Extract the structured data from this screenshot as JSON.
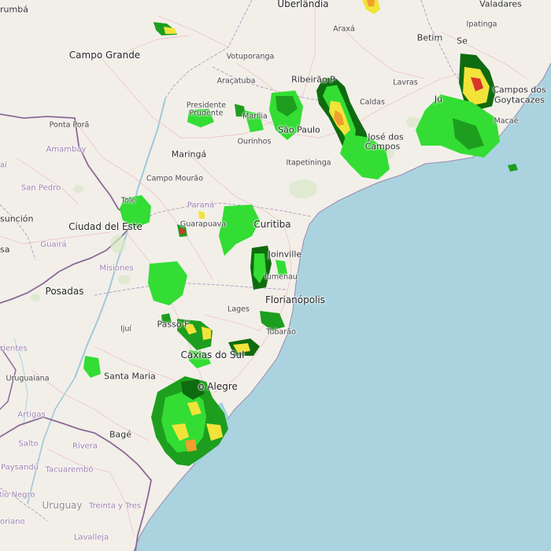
{
  "map": {
    "colors": {
      "land": "#f2efe9",
      "water": "#aad3df",
      "radar_light": "#33dd33",
      "radar_mid": "#1e9e1e",
      "radar_dark": "#0f6b0f",
      "radar_yellow": "#f2e33a",
      "radar_orange": "#f29e2e",
      "radar_red": "#d9342b",
      "border": "#8c6a97",
      "road": "#f2b7b7"
    },
    "labels": {
      "uberlandia": "Uberlândia",
      "umbara": "rumbá",
      "valadares": "Valadares",
      "araxa": "Araxá",
      "belo": "Betim",
      "se": "Se",
      "ipatinga": "Ipatinga",
      "campo_grande": "Campo Grande",
      "votuporanga": "Votuporanga",
      "aracatuba": "Araçatuba",
      "ribeirao": "Ribeirão P",
      "lavras": "Lavras",
      "campos": "Campos dos",
      "goytacazes": "Goytacazes",
      "ju": "Ju",
      "presidente": "Presidente",
      "prudente": "Prudente",
      "marilia": "Marília",
      "caldas": "Caldas",
      "ponta_pora": "Ponta Porã",
      "sao_paulo": "São Paulo",
      "jose_dos": "José dos",
      "campos2": "Campos",
      "macae": "Macaé",
      "amambay": "Amambay",
      "ourinhos": "Ourinhos",
      "maringa": "Maringá",
      "ai": "ai",
      "itapetininga": "Itapetininga",
      "san_pedro": "San Pedro",
      "campo_mourao": "Campo Mourão",
      "toledo": "Tole",
      "parana": "Paraná",
      "asuncion": "sunción",
      "ciudad_del_este": "Ciudad del Este",
      "guarapuava": "Guarapuava",
      "curitiba": "Curitiba",
      "guaira": "Guairá",
      "sa": "sa",
      "joinville": "Joinville",
      "misiones": "Misiones",
      "blumenau": "lumenau",
      "posadas": "Posadas",
      "florianopolis": "Florianópolis",
      "lages": "Lages",
      "passo_fundo": "Passo F",
      "ijui": "Ijuí",
      "tubarao": "Tubarão",
      "rientes": "rientes",
      "caxias": "Caxias do Sul",
      "santa_maria": "Santa Maria",
      "uruguaiana": "Uruguaiana",
      "porto_alegre": "o Alegre",
      "artigas": "Artigas",
      "bage": "Bagé",
      "salto": "Salto",
      "rivera": "Rivera",
      "paysandu": "Paysandú",
      "tacuarembo": "Tacuarembó",
      "rio_negro": "Río Negro",
      "treinta": "Treinta y Tres",
      "uruguay": "Uruguay",
      "oriano": "oriano",
      "lavalleja": "Lavalleja"
    }
  }
}
